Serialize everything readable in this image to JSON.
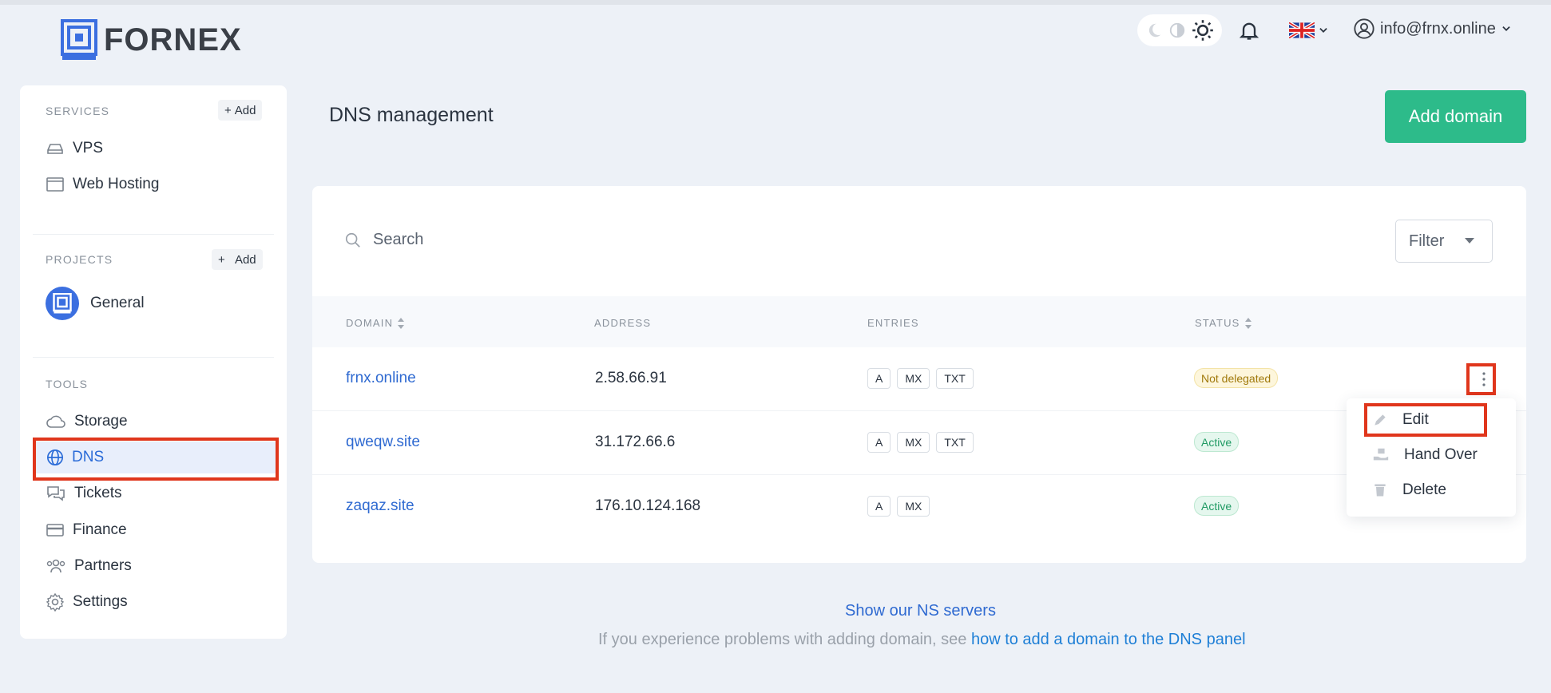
{
  "header": {
    "logo_text": "FORNEX",
    "user_email": "info@frnx.online",
    "icons": [
      "moon-icon",
      "half-moon-icon",
      "sun-icon",
      "bell-icon",
      "uk-flag-icon",
      "user-circle-icon"
    ]
  },
  "sidebar": {
    "services_title": "SERVICES",
    "services_add": "Add",
    "services": [
      {
        "label": "VPS",
        "icon": "server-icon"
      },
      {
        "label": "Web Hosting",
        "icon": "browser-window-icon"
      }
    ],
    "projects_title": "PROJECTS",
    "projects_add": "Add",
    "projects": [
      {
        "label": "General",
        "icon": "project-logo-icon"
      }
    ],
    "tools_title": "TOOLS",
    "tools": [
      {
        "label": "Storage",
        "icon": "cloud-icon"
      },
      {
        "label": "DNS",
        "icon": "globe-icon",
        "active": true
      },
      {
        "label": "Tickets",
        "icon": "chat-icon"
      },
      {
        "label": "Finance",
        "icon": "credit-card-icon"
      },
      {
        "label": "Partners",
        "icon": "users-icon"
      },
      {
        "label": "Settings",
        "icon": "gear-icon"
      }
    ]
  },
  "main": {
    "title": "DNS management",
    "add_domain": "Add domain",
    "search_placeholder": "Search",
    "filter_label": "Filter",
    "columns": [
      "DOMAIN",
      "ADDRESS",
      "ENTRIES",
      "STATUS"
    ],
    "rows": [
      {
        "domain": "frnx.online",
        "address": "2.58.66.91",
        "entries": [
          "A",
          "MX",
          "TXT"
        ],
        "status": "Not delegated"
      },
      {
        "domain": "qweqw.site",
        "address": "31.172.66.6",
        "entries": [
          "A",
          "MX",
          "TXT"
        ],
        "status": "Active"
      },
      {
        "domain": "zaqaz.site",
        "address": "176.10.124.168",
        "entries": [
          "A",
          "MX"
        ],
        "status": "Active"
      }
    ],
    "row_menu": [
      {
        "label": "Edit",
        "icon": "pencil-icon"
      },
      {
        "label": "Hand Over",
        "icon": "hand-over-icon"
      },
      {
        "label": "Delete",
        "icon": "trash-icon"
      }
    ]
  },
  "footer": {
    "ns_link": "Show our NS servers",
    "help_prefix": "If you experience problems with adding domain, see",
    "help_link": "how to add a domain to the DNS panel"
  },
  "colors": {
    "accent": "#2f6ad1",
    "primary_button": "#2dbb8a",
    "highlight": "#e0361c",
    "background": "#edf1f7"
  }
}
